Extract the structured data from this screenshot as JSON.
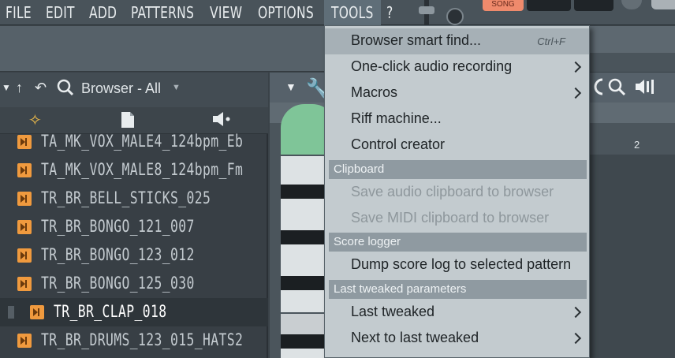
{
  "menubar": {
    "items": [
      "FILE",
      "EDIT",
      "ADD",
      "PATTERNS",
      "VIEW",
      "OPTIONS",
      "TOOLS",
      "?"
    ],
    "active": "TOOLS"
  },
  "transport": {
    "song_label": "SONG"
  },
  "browser": {
    "title": "Browser - All",
    "files": [
      "TA_MK_VOX_MALE4_124bpm_Eb",
      "TA_MK_VOX_MALE8_124bpm_Fm",
      "TR_BR_BELL_STICKS_025",
      "TR_BR_BONGO_121_007",
      "TR_BR_BONGO_123_012",
      "TR_BR_BONGO_125_030",
      "TR_BR_CLAP_018",
      "TR_BR_DRUMS_123_015_HATS2"
    ],
    "selected_index": 6
  },
  "roll": {
    "ruler_mark": "2"
  },
  "tools_menu": {
    "items": [
      {
        "label": "Browser smart find...",
        "shortcut": "Ctrl+F",
        "highlight": true
      },
      {
        "label": "One-click audio recording",
        "submenu": true
      },
      {
        "label": "Macros",
        "submenu": true
      },
      {
        "label": "Riff machine..."
      },
      {
        "label": "Control creator"
      }
    ],
    "sections": {
      "clipboard": "Clipboard",
      "score_logger": "Score logger",
      "last_tweaked": "Last tweaked parameters"
    },
    "clipboard_items": [
      "Save audio clipboard to browser",
      "Save MIDI clipboard to browser"
    ],
    "score_items": [
      "Dump score log to selected pattern"
    ],
    "tweak_items": [
      "Last tweaked",
      "Next to last tweaked"
    ]
  },
  "colors": {
    "menubar": "#49535a",
    "menu_bg": "#c3cbcf",
    "section_bg": "#8f9aa1",
    "file_icon": "#f09a3e",
    "song_button": "#ef8a6c",
    "clip_green": "#7fc598"
  }
}
